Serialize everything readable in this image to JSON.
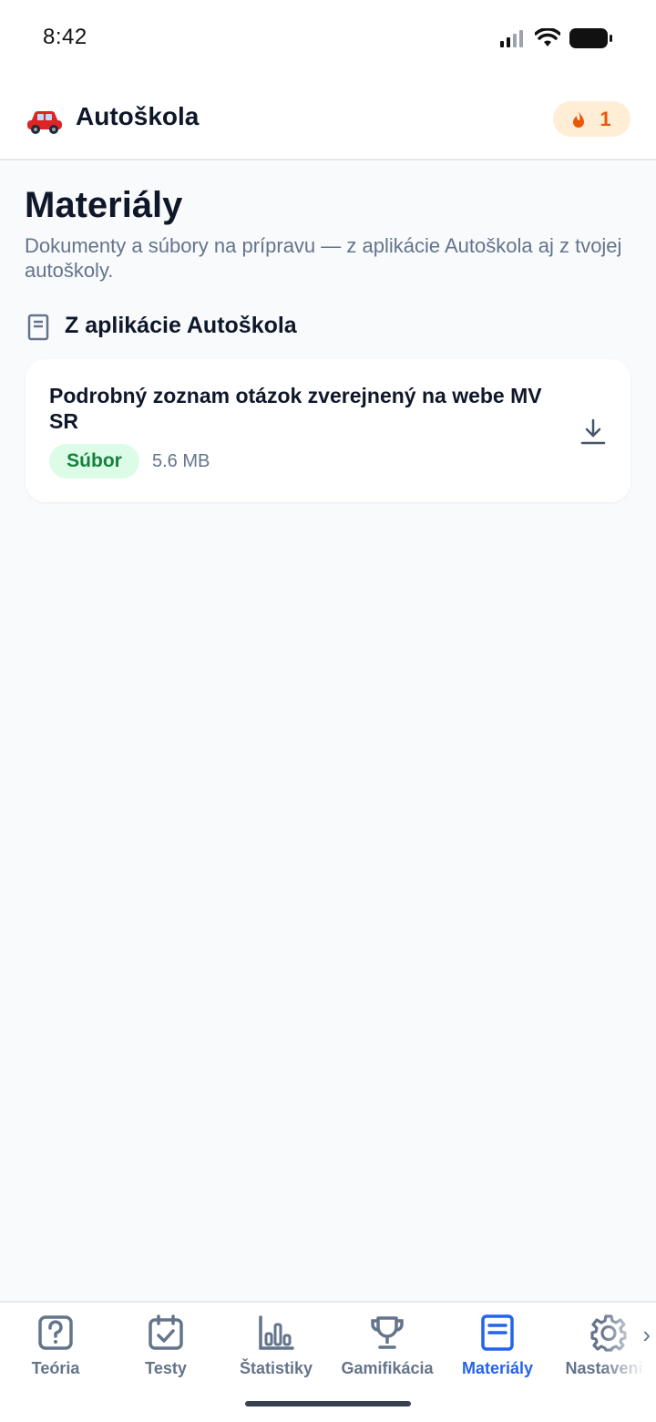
{
  "status_bar": {
    "time": "8:42"
  },
  "header": {
    "app_icon": "red-car-icon",
    "app_title": "Autoškola",
    "streak_count": "1",
    "streak_icon": "flame-icon"
  },
  "page": {
    "title": "Materiály",
    "subtitle": "Dokumenty a súbory na prípravu — z aplikácie Autoškola aj z tvojej autoškoly."
  },
  "section": {
    "title": "Z aplikácie Autoškola",
    "icon": "book-icon"
  },
  "materials": [
    {
      "title": "Podrobný zoznam otázok zverejnený na webe MV SR",
      "badge": "Súbor",
      "size": "5.6 MB",
      "action_icon": "download-icon"
    }
  ],
  "tabs": [
    {
      "label": "Teória",
      "icon": "question-square-icon",
      "active": false
    },
    {
      "label": "Testy",
      "icon": "calendar-check-icon",
      "active": false
    },
    {
      "label": "Štatistiky",
      "icon": "bar-chart-icon",
      "active": false
    },
    {
      "label": "Gamifikácia",
      "icon": "trophy-icon",
      "active": false
    },
    {
      "label": "Materiály",
      "icon": "document-icon",
      "active": true
    },
    {
      "label": "Nastavenia",
      "icon": "gear-icon",
      "active": false
    }
  ],
  "colors": {
    "accent": "#2563eb",
    "badge_bg": "#dcfce7",
    "badge_text": "#15803d",
    "streak_bg": "#ffedd5",
    "streak_text": "#ea580c"
  }
}
